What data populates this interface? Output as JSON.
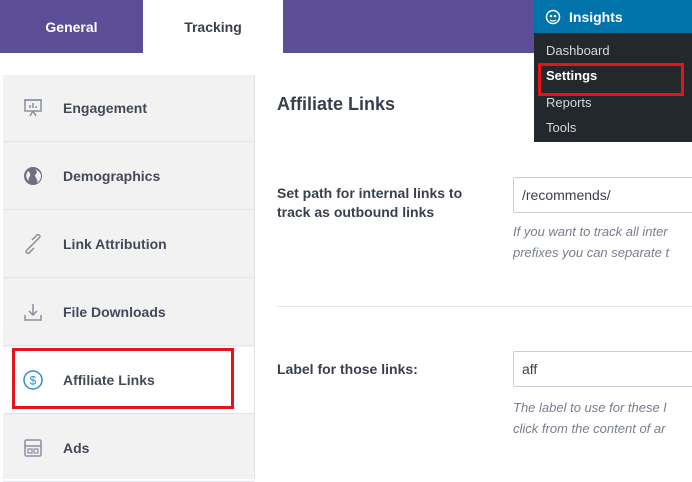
{
  "tabs": [
    {
      "label": "General"
    },
    {
      "label": "Tracking"
    }
  ],
  "sidebar": {
    "items": [
      {
        "label": "Engagement",
        "icon": "presentation-icon"
      },
      {
        "label": "Demographics",
        "icon": "globe-icon"
      },
      {
        "label": "Link Attribution",
        "icon": "link-icon"
      },
      {
        "label": "File Downloads",
        "icon": "download-icon"
      },
      {
        "label": "Affiliate Links",
        "icon": "dollar-circle-icon"
      },
      {
        "label": "Ads",
        "icon": "ad-layout-icon"
      }
    ]
  },
  "main": {
    "title": "Affiliate Links",
    "path_field": {
      "label": "Set path for internal links to track as outbound links",
      "value": "/recommends/",
      "help_line1": "If you want to track all inter",
      "help_line2": "prefixes you can separate t"
    },
    "label_field": {
      "label": "Label for those links:",
      "value": "aff",
      "help_line1": "The label to use for these l",
      "help_line2": "click from the content of ar"
    }
  },
  "wp_menu": {
    "header": "Insights",
    "items": [
      {
        "label": "Dashboard"
      },
      {
        "label": "Settings"
      },
      {
        "label": "Reports"
      },
      {
        "label": "Tools"
      }
    ]
  },
  "colors": {
    "tab_bar": "#5b4e96",
    "highlight": "#e8121b",
    "wp_menu_bg": "#23282d",
    "wp_menu_header": "#0073aa"
  }
}
